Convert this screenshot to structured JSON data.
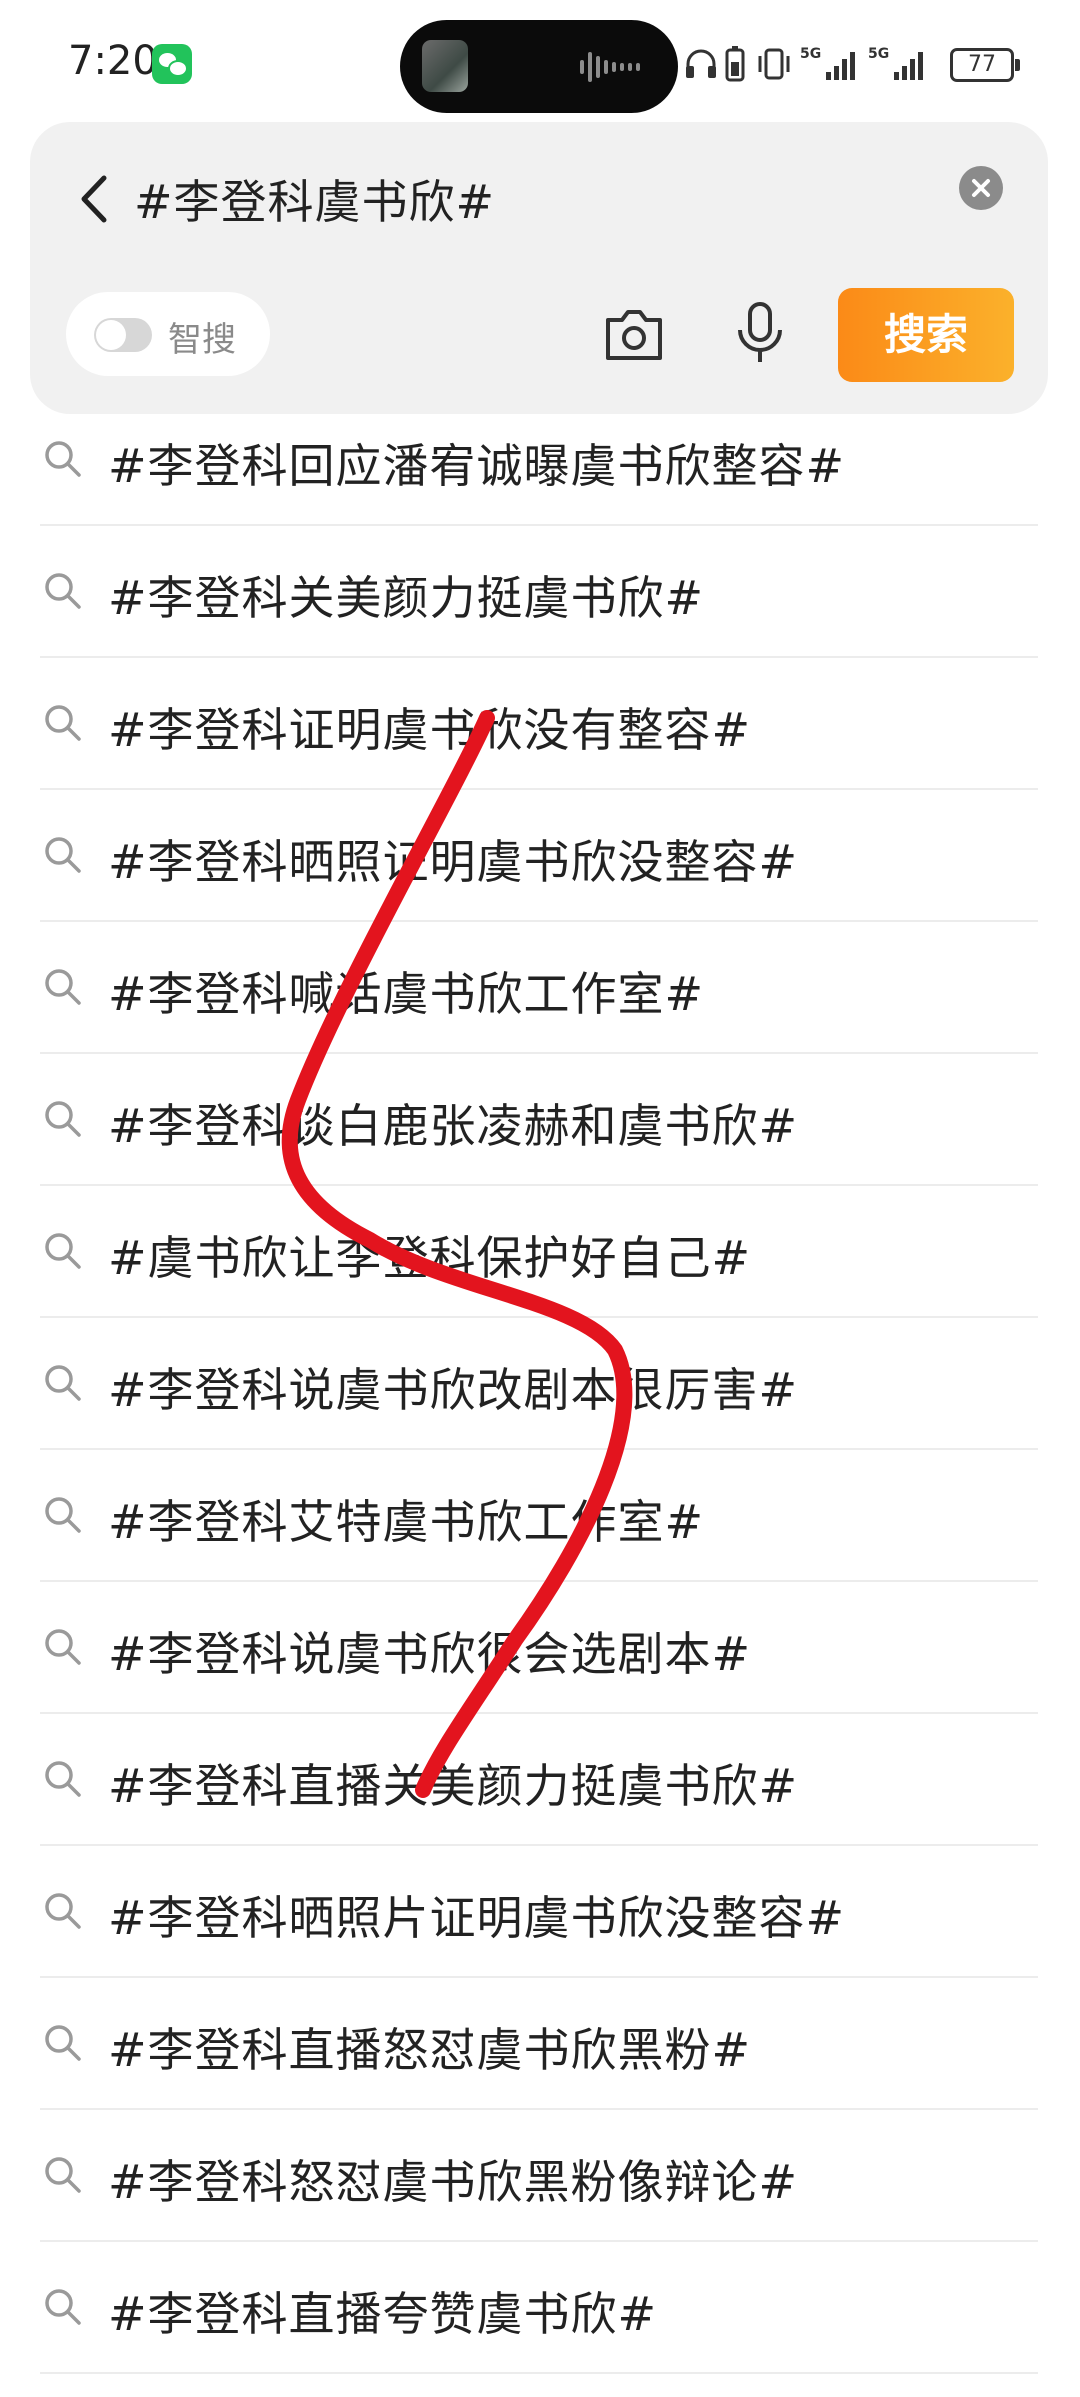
{
  "status_bar": {
    "time": "7:20",
    "battery": "77"
  },
  "search": {
    "back_icon": "chevron-left-icon",
    "query": "#李登科虞书欣#",
    "clear_icon": "close-circle-icon",
    "smart_label": "智搜",
    "smart_enabled": false,
    "camera_icon": "camera-icon",
    "mic_icon": "microphone-icon",
    "search_button": "搜索",
    "accent_color": "#fb9a1f"
  },
  "suggestions": [
    "#李登科回应潘宥诚曝虞书欣整容#",
    "#李登科关美颜力挺虞书欣#",
    "#李登科证明虞书欣没有整容#",
    "#李登科晒照证明虞书欣没整容#",
    "#李登科喊话虞书欣工作室#",
    "#李登科谈白鹿张凌赫和虞书欣#",
    "#虞书欣让李登科保护好自己#",
    "#李登科说虞书欣改剧本很厉害#",
    "#李登科艾特虞书欣工作室#",
    "#李登科说虞书欣很会选剧本#",
    "#李登科直播关美颜力挺虞书欣#",
    "#李登科晒照片证明虞书欣没整容#",
    "#李登科直播怒怼虞书欣黑粉#",
    "#李登科怒怼虞书欣黑粉像辩论#",
    "#李登科直播夸赞虞书欣#"
  ],
  "annotation": {
    "stroke_color": "#e3141e"
  }
}
